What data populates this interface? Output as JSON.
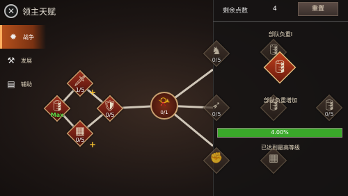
{
  "header": {
    "title": "领主天赋",
    "close_icon": "close-icon"
  },
  "sidebar": {
    "items": [
      {
        "label": "战争",
        "icon": "war-icon",
        "active": true
      },
      {
        "label": "发展",
        "icon": "hammer-icon",
        "active": false
      },
      {
        "label": "辅助",
        "icon": "scroll-icon",
        "active": false
      }
    ]
  },
  "tree": {
    "nodes": {
      "sword": {
        "level": "1/5",
        "icon": "sword-icon"
      },
      "barrels": {
        "level": "Max",
        "icon": "barrels-icon"
      },
      "shield": {
        "level": "0/5",
        "icon": "shield-icon"
      },
      "crate": {
        "level": "0/5",
        "icon": "crate-icon"
      },
      "horn": {
        "level": "0/1",
        "icon": "horn-icon"
      },
      "horse": {
        "level": "0/5",
        "icon": "horse-icon"
      },
      "top_barrels": {
        "level": "",
        "icon": "barrels-icon"
      },
      "arrows": {
        "level": "0/5",
        "icon": "arrows-icon"
      },
      "mid_right": {
        "level": "",
        "icon": "barrels-icon"
      },
      "right_barrels": {
        "level": "0/5",
        "icon": "barrels-icon"
      },
      "bottom_left": {
        "level": "",
        "icon": "fist-icon"
      },
      "bottom_mid": {
        "level": "",
        "icon": "crate-icon"
      }
    }
  },
  "panel": {
    "points_label": "剩余点数",
    "points_value": "4",
    "reset_label": "重置",
    "detail_title": "部队负重I",
    "effect_label": "部队负重增加",
    "progress_text": "4.00%",
    "progress_fraction": 1.0,
    "maxed_text": "已达到最高等级"
  }
}
